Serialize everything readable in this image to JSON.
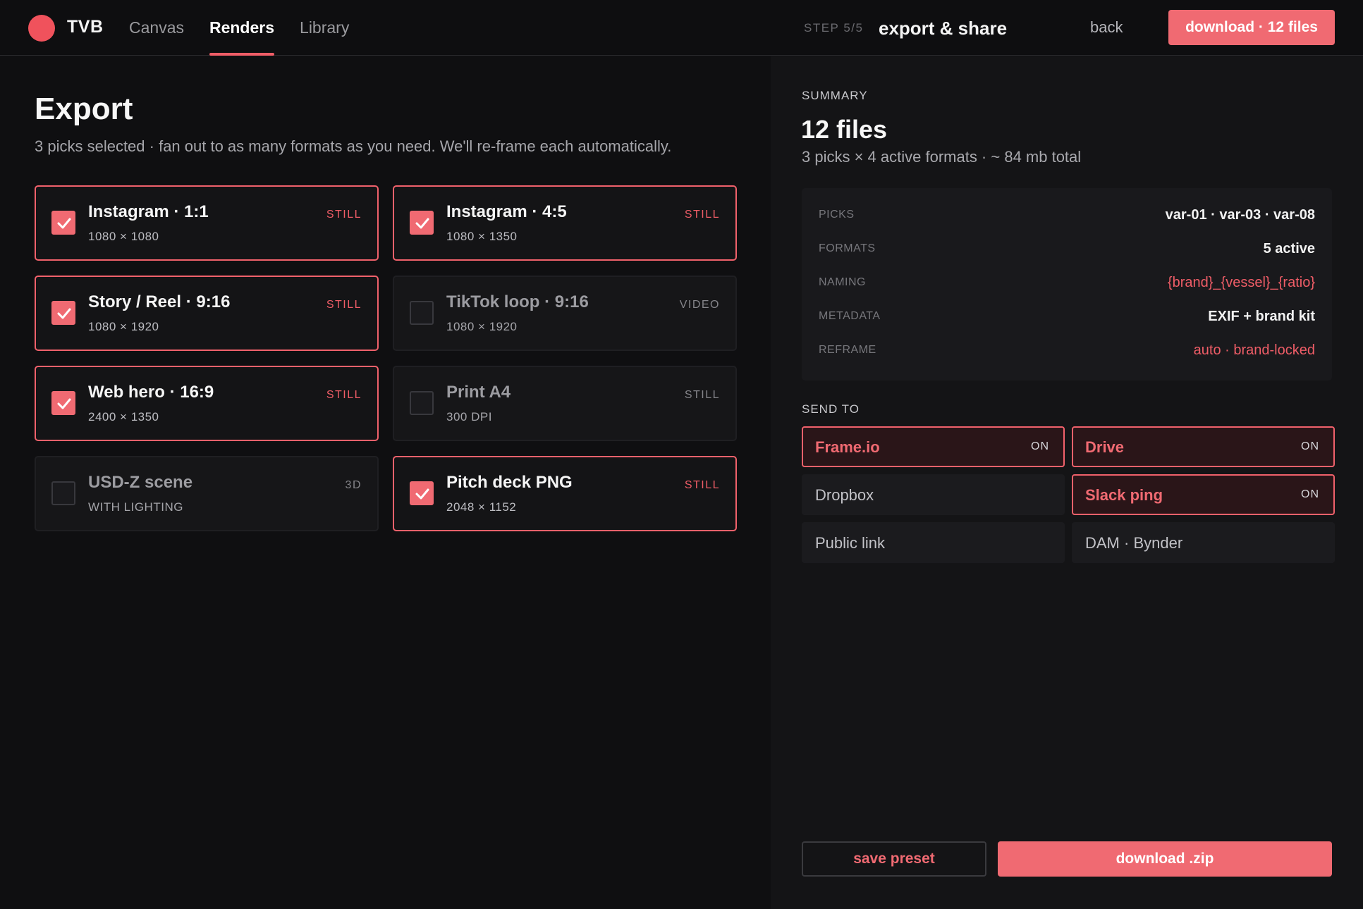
{
  "app": {
    "brand": "TVB"
  },
  "nav": {
    "items": [
      {
        "label": "Canvas"
      },
      {
        "label": "Renders"
      },
      {
        "label": "Library"
      }
    ],
    "active": "Renders"
  },
  "header": {
    "step": "STEP 5/5",
    "title": "export & share",
    "back_label": "back",
    "download_label": "download · 12 files"
  },
  "export": {
    "title": "Export",
    "subtitle": "3 picks selected · fan out to as many formats as you need. We'll re-frame each automatically.",
    "formats": [
      {
        "title": "Instagram · 1:1",
        "dims": "1080 × 1080",
        "kind": "STILL",
        "checked": true
      },
      {
        "title": "Instagram · 4:5",
        "dims": "1080 × 1350",
        "kind": "STILL",
        "checked": true
      },
      {
        "title": "Story / Reel · 9:16",
        "dims": "1080 × 1920",
        "kind": "STILL",
        "checked": true
      },
      {
        "title": "TikTok loop · 9:16",
        "dims": "1080 × 1920",
        "kind": "VIDEO",
        "checked": false
      },
      {
        "title": "Web hero · 16:9",
        "dims": "2400 × 1350",
        "kind": "STILL",
        "checked": true
      },
      {
        "title": "Print A4",
        "dims": "300 DPI",
        "kind": "STILL",
        "checked": false
      },
      {
        "title": "USD-Z scene",
        "dims": "WITH LIGHTING",
        "kind": "3D",
        "checked": false
      },
      {
        "title": "Pitch deck PNG",
        "dims": "2048 × 1152",
        "kind": "STILL",
        "checked": true
      }
    ]
  },
  "summary": {
    "label": "SUMMARY",
    "count": "12 files",
    "sub": "3 picks × 4 active formats · ~ 84 mb total",
    "rows": [
      {
        "key": "PICKS",
        "value": "var-01 · var-03 · var-08"
      },
      {
        "key": "FORMATS",
        "value": "5 active"
      },
      {
        "key": "NAMING",
        "value": "{brand}_{vessel}_{ratio}"
      },
      {
        "key": "METADATA",
        "value": "EXIF + brand kit"
      },
      {
        "key": "REFRAME",
        "value": "auto · brand-locked"
      }
    ]
  },
  "send_to": {
    "label": "SEND TO",
    "destinations": [
      {
        "name": "Frame.io",
        "state": "ON",
        "on": true
      },
      {
        "name": "Drive",
        "state": "ON",
        "on": true
      },
      {
        "name": "Dropbox",
        "state": "",
        "on": false
      },
      {
        "name": "Slack ping",
        "state": "ON",
        "on": true
      },
      {
        "name": "Public link",
        "state": "",
        "on": false
      },
      {
        "name": "DAM · Bynder",
        "state": "",
        "on": false
      }
    ]
  },
  "actions": {
    "save_preset": "save preset",
    "download_zip": "download .zip"
  },
  "colors": {
    "accent": "#f06a72",
    "background": "#101012",
    "panel": "#141416"
  }
}
